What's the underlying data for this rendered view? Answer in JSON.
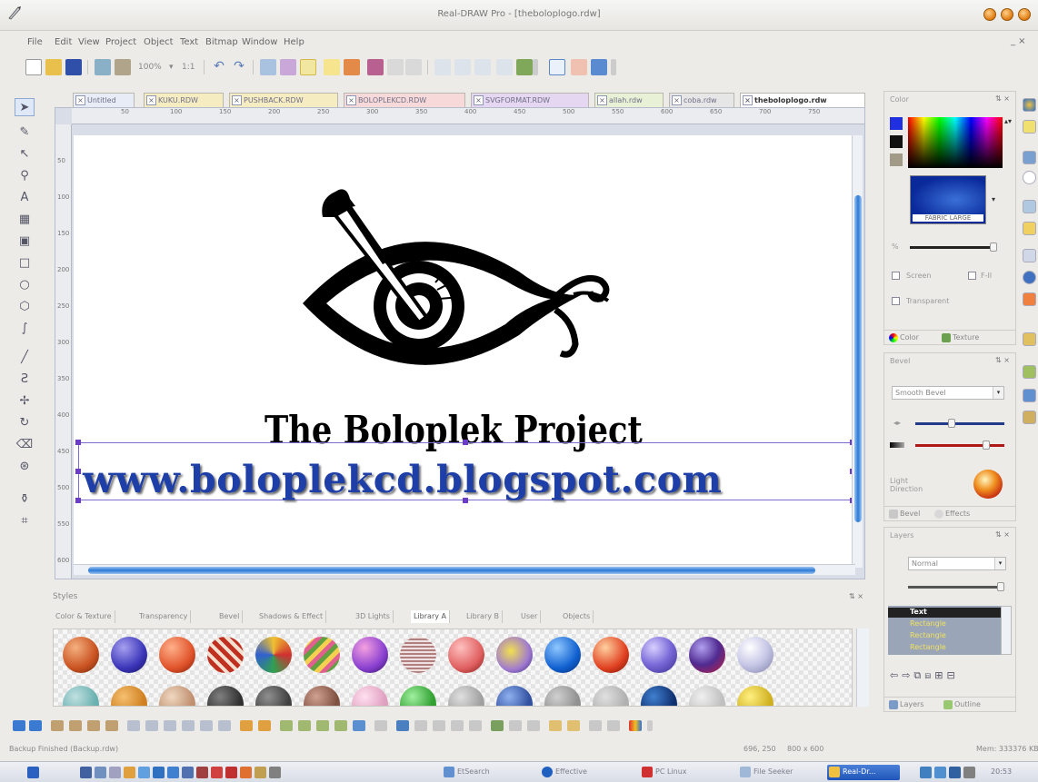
{
  "window": {
    "title": "Real-DRAW Pro - [theboloplogo.rdw]"
  },
  "menu": [
    "File",
    "Edit",
    "View",
    "Project",
    "Object",
    "Text",
    "Bitmap",
    "Window",
    "Help"
  ],
  "mdi_controls": "_ ×",
  "toolbar": {
    "zoom": "100%",
    "ratio": "1:1"
  },
  "doc_tabs": [
    {
      "label": "Untitled",
      "color": "#e8ecf6"
    },
    {
      "label": "KUKU.RDW",
      "color": "#f6ecc2"
    },
    {
      "label": "PUSHBACK.RDW",
      "color": "#f6ecc2"
    },
    {
      "label": "BOLOPLEKCD.RDW",
      "color": "#f7d9d9"
    },
    {
      "label": "SVGFORMAT.RDW",
      "color": "#e5d6f1"
    },
    {
      "label": "allah.rdw",
      "color": "#e8f1d5"
    },
    {
      "label": "coba.rdw",
      "color": "#e6e6e6"
    },
    {
      "label": "theboloplogo.rdw",
      "color": "#ffffff"
    }
  ],
  "ruler_h": [
    "50",
    "100",
    "150",
    "200",
    "250",
    "300",
    "350",
    "400",
    "450",
    "500",
    "550",
    "600",
    "650",
    "700",
    "750"
  ],
  "ruler_v": [
    "50",
    "100",
    "150",
    "200",
    "250",
    "300",
    "350",
    "400",
    "450",
    "500",
    "550",
    "600"
  ],
  "canvas": {
    "logo_title": "The Boloplek Project",
    "url_text": "www.boloplekcd.blogspot.com"
  },
  "styles": {
    "title": "Styles",
    "tabs": [
      "Color & Texture",
      "Transparency",
      "Bevel",
      "Shadows & Effect",
      "3D Lights",
      "Library A",
      "Library B",
      "User",
      "Objects"
    ],
    "active_tab": "Library A"
  },
  "color_panel": {
    "title": "Color",
    "fabric_label": "FABRIC LARGE",
    "screen_label": "Screen",
    "fill_label": "F-Il",
    "transparent_label": "Transparent",
    "tabs": [
      "Color",
      "Texture"
    ]
  },
  "bevel_panel": {
    "title": "Bevel",
    "type": "Smooth Bevel",
    "light_label": "Light\nDirection",
    "tabs": [
      "Bevel",
      "Effects"
    ]
  },
  "layers_panel": {
    "title": "Layers",
    "mode": "Normal",
    "items": [
      "Text",
      "Rectangle",
      "Rectangle",
      "Rectangle"
    ],
    "tabs": [
      "Layers",
      "Outline"
    ]
  },
  "status": {
    "left": "Backup Finished (Backup.rdw)",
    "coords": "696, 250",
    "size": "800 x 600",
    "mem": "Mem: 333376 KB"
  },
  "taskbar": {
    "tasks": [
      "EtSearch",
      "Effective",
      "PC Linux",
      "File Seeker",
      "Real-Dr..."
    ],
    "time": "20:53"
  },
  "colors": {
    "accent": "#2a7ad8",
    "url_blue": "#1f3fa8",
    "selection": "#6a3cc9"
  }
}
